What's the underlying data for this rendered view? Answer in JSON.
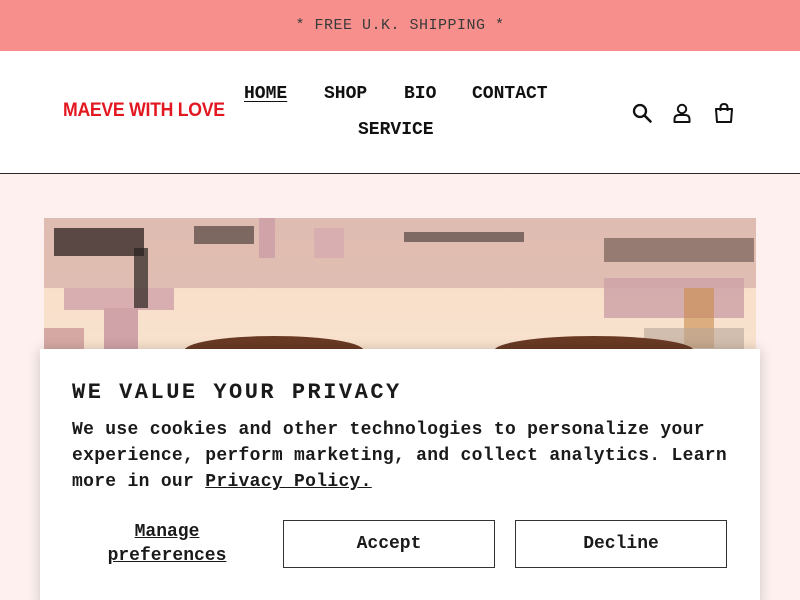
{
  "announcement": {
    "text": "* FREE U.K. SHIPPING *"
  },
  "header": {
    "logo_text": "MAEVE WITH LOVE",
    "nav": [
      {
        "label": "HOME",
        "active": true
      },
      {
        "label": "SHOP",
        "active": false
      },
      {
        "label": "BIO",
        "active": false
      },
      {
        "label": "CONTACT",
        "active": false
      },
      {
        "label": "SERVICE",
        "active": false
      }
    ],
    "icons": [
      "search-icon",
      "account-icon",
      "cart-icon"
    ]
  },
  "cookie_banner": {
    "title": "WE VALUE YOUR PRIVACY",
    "body": "We use cookies and other technologies to personalize your experience, perform marketing, and collect analytics. Learn more in our ",
    "policy_link": "Privacy Policy.",
    "manage_label": "Manage preferences",
    "accept_label": "Accept",
    "decline_label": "Decline"
  },
  "colors": {
    "announcement_bg": "#f7908c",
    "page_bg": "#fdf0ef",
    "logo": "#e3171f"
  }
}
